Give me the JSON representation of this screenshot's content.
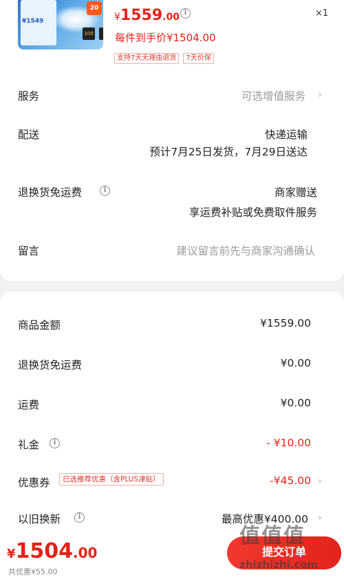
{
  "product": {
    "thumb_price": "¥1549",
    "thumb_promo": "20",
    "thumb_badge": "100",
    "price_currency": "¥",
    "price_integer": "1559",
    "price_decimal": ".00",
    "quantity": "×1",
    "unit_price": "每件到手价¥1504.00",
    "tags": [
      "支持7天无理由退货",
      "7天价保"
    ]
  },
  "service": {
    "label": "服务",
    "value": "可选增值服务"
  },
  "delivery": {
    "label": "配送",
    "method": "快递运输",
    "eta": "预计7月25日发货，7月29日送达"
  },
  "returns": {
    "label": "退换货免运费",
    "value": "商家赠送",
    "desc": "享运费补贴或免费取件服务"
  },
  "note": {
    "label": "留言",
    "placeholder": "建议留言前先与商家沟通确认"
  },
  "summary": {
    "goods_amount": {
      "label": "商品金额",
      "value": "¥1559.00"
    },
    "return_shipping": {
      "label": "退换货免运费",
      "value": "¥0.00"
    },
    "shipping": {
      "label": "运费",
      "value": "¥0.00"
    },
    "gift": {
      "label": "礼金",
      "value": "- ¥10.00"
    },
    "coupon": {
      "label": "优惠券",
      "tag": "已选推荐优惠（含PLUS津贴）",
      "value": "-¥45.00"
    },
    "trade_in": {
      "label": "以旧换新",
      "value": "最高优惠¥400.00"
    }
  },
  "footer": {
    "total_currency": "¥",
    "total_integer": "1504",
    "total_decimal": ".00",
    "saved": "共优惠¥55.00",
    "submit_label": "提交订单"
  },
  "watermark": {
    "title": "值值值",
    "url": "zhizhizhi.com"
  },
  "colors": {
    "accent": "#e2231a",
    "background": "#f2f2f2"
  }
}
